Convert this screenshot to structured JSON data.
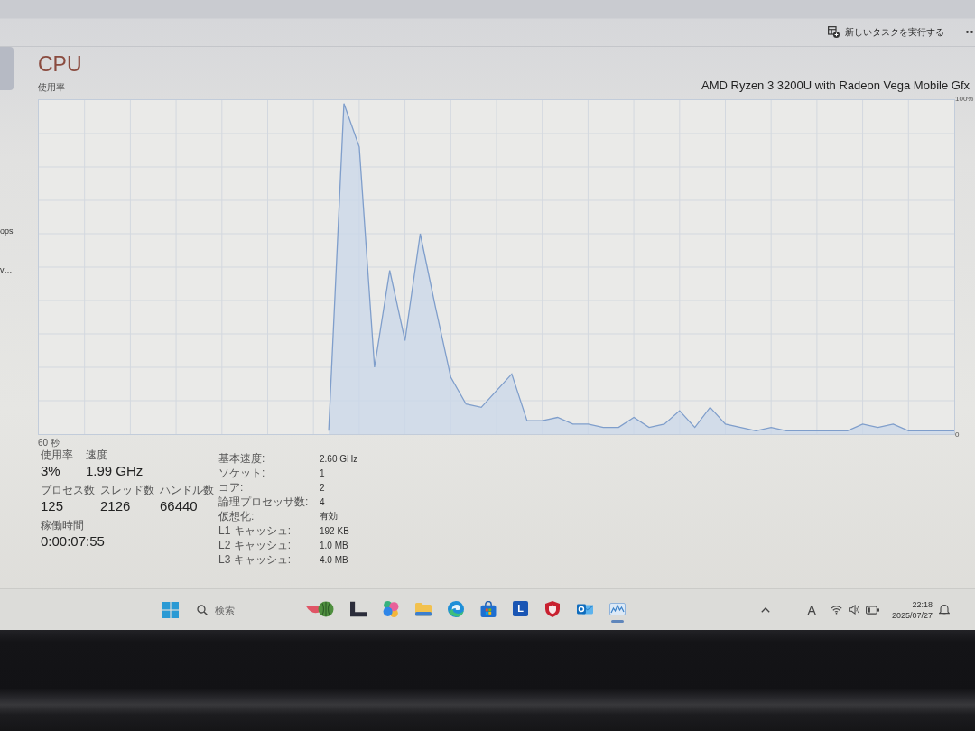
{
  "toolbar": {
    "run_task_button": "新しいタスクを実行する"
  },
  "sidebar": {
    "items": [
      {
        "selected": true
      },
      {
        "label": "ops",
        "selected": false
      },
      {
        "label": "v…",
        "selected": false
      }
    ]
  },
  "performance": {
    "title": "CPU",
    "processor": "AMD Ryzen 3 3200U with Radeon Vega Mobile Gfx",
    "chart_data": {
      "type": "area",
      "ylabel": "使用率",
      "xlabel": "60 秒",
      "grid": true,
      "categories": [
        null,
        null,
        null,
        null,
        null,
        null,
        null,
        null,
        null,
        null,
        null,
        null,
        null,
        null,
        null,
        null,
        null,
        null,
        null,
        null,
        null,
        null,
        null,
        null,
        null,
        null,
        null,
        null,
        null,
        null,
        null,
        null,
        null,
        null,
        null,
        null,
        null,
        null,
        null,
        null,
        null,
        null,
        null,
        null,
        null,
        null,
        null,
        null,
        null,
        null,
        null,
        null,
        null,
        null,
        null,
        null,
        null,
        null,
        null,
        null,
        null
      ],
      "values": [
        null,
        null,
        null,
        null,
        null,
        null,
        null,
        null,
        null,
        null,
        null,
        null,
        null,
        null,
        null,
        null,
        null,
        null,
        null,
        1,
        99,
        86,
        20,
        49,
        28,
        60,
        38,
        17,
        9,
        8,
        13,
        18,
        4,
        4,
        5,
        3,
        3,
        2,
        2,
        5,
        2,
        3,
        7,
        2,
        8,
        3,
        2,
        1,
        2,
        1,
        1,
        1,
        1,
        1,
        3,
        2,
        3,
        1,
        1,
        1,
        1
      ],
      "ylim": [
        0,
        100
      ],
      "yticks": [
        {
          "value": 0,
          "label": "0"
        },
        {
          "value": 100,
          "label": "100%"
        }
      ]
    },
    "stat_rows": [
      [
        {
          "label": "使用率",
          "value": "3%"
        },
        {
          "label": "速度",
          "value": "1.99 GHz"
        }
      ],
      [
        {
          "label": "プロセス数",
          "value": "125"
        },
        {
          "label": "スレッド数",
          "value": "2126"
        },
        {
          "label": "ハンドル数",
          "value": "66440"
        }
      ],
      [
        {
          "label": "稼働時間",
          "value": "0:00:07:55"
        }
      ]
    ],
    "details": [
      {
        "label": "基本速度:",
        "value": "2.60 GHz"
      },
      {
        "label": "ソケット:",
        "value": "1"
      },
      {
        "label": "コア:",
        "value": "2"
      },
      {
        "label": "論理プロセッサ数:",
        "value": "4"
      },
      {
        "label": "仮想化:",
        "value": "有効"
      },
      {
        "label": "L1 キャッシュ:",
        "value": "192 KB"
      },
      {
        "label": "L2 キャッシュ:",
        "value": "1.0 MB"
      },
      {
        "label": "L3 キャッシュ:",
        "value": "4.0 MB"
      }
    ]
  },
  "taskbar": {
    "search": {
      "placeholder": "検索"
    },
    "apps": [
      {
        "kind": "melon",
        "active": false
      },
      {
        "kind": "corner",
        "active": false
      },
      {
        "kind": "swirl",
        "active": false
      },
      {
        "kind": "folder",
        "active": false
      },
      {
        "kind": "wave",
        "active": false
      },
      {
        "kind": "bag",
        "active": false
      },
      {
        "kind": "tile",
        "glyph": "L",
        "active": false
      },
      {
        "kind": "shield",
        "active": false
      },
      {
        "kind": "envelope",
        "active": false
      },
      {
        "kind": "chart",
        "active": true
      }
    ],
    "tray": {
      "ime": "A",
      "time": "22:18",
      "date": "2025/07/27"
    }
  }
}
